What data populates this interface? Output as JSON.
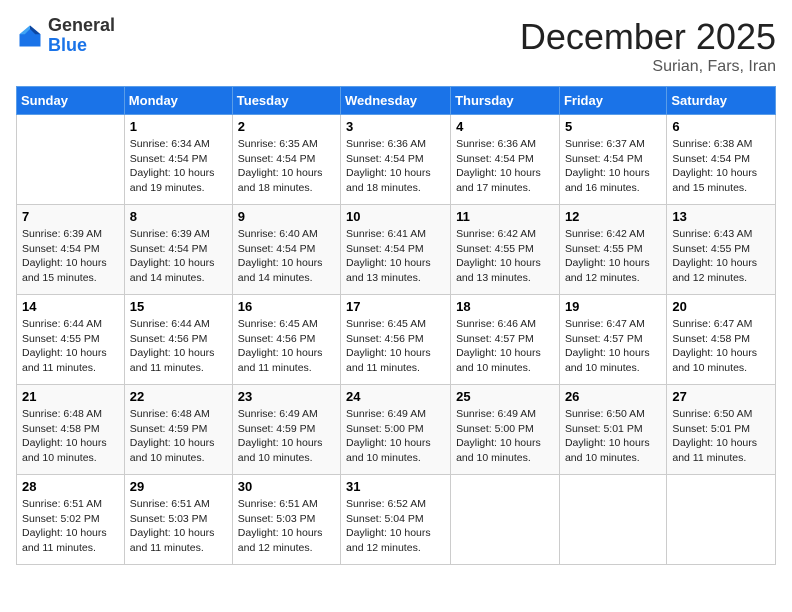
{
  "header": {
    "logo_general": "General",
    "logo_blue": "Blue",
    "title": "December 2025",
    "subtitle": "Surian, Fars, Iran"
  },
  "days_of_week": [
    "Sunday",
    "Monday",
    "Tuesday",
    "Wednesday",
    "Thursday",
    "Friday",
    "Saturday"
  ],
  "weeks": [
    [
      {
        "day": "",
        "info": ""
      },
      {
        "day": "1",
        "info": "Sunrise: 6:34 AM\nSunset: 4:54 PM\nDaylight: 10 hours\nand 19 minutes."
      },
      {
        "day": "2",
        "info": "Sunrise: 6:35 AM\nSunset: 4:54 PM\nDaylight: 10 hours\nand 18 minutes."
      },
      {
        "day": "3",
        "info": "Sunrise: 6:36 AM\nSunset: 4:54 PM\nDaylight: 10 hours\nand 18 minutes."
      },
      {
        "day": "4",
        "info": "Sunrise: 6:36 AM\nSunset: 4:54 PM\nDaylight: 10 hours\nand 17 minutes."
      },
      {
        "day": "5",
        "info": "Sunrise: 6:37 AM\nSunset: 4:54 PM\nDaylight: 10 hours\nand 16 minutes."
      },
      {
        "day": "6",
        "info": "Sunrise: 6:38 AM\nSunset: 4:54 PM\nDaylight: 10 hours\nand 15 minutes."
      }
    ],
    [
      {
        "day": "7",
        "info": "Sunrise: 6:39 AM\nSunset: 4:54 PM\nDaylight: 10 hours\nand 15 minutes."
      },
      {
        "day": "8",
        "info": "Sunrise: 6:39 AM\nSunset: 4:54 PM\nDaylight: 10 hours\nand 14 minutes."
      },
      {
        "day": "9",
        "info": "Sunrise: 6:40 AM\nSunset: 4:54 PM\nDaylight: 10 hours\nand 14 minutes."
      },
      {
        "day": "10",
        "info": "Sunrise: 6:41 AM\nSunset: 4:54 PM\nDaylight: 10 hours\nand 13 minutes."
      },
      {
        "day": "11",
        "info": "Sunrise: 6:42 AM\nSunset: 4:55 PM\nDaylight: 10 hours\nand 13 minutes."
      },
      {
        "day": "12",
        "info": "Sunrise: 6:42 AM\nSunset: 4:55 PM\nDaylight: 10 hours\nand 12 minutes."
      },
      {
        "day": "13",
        "info": "Sunrise: 6:43 AM\nSunset: 4:55 PM\nDaylight: 10 hours\nand 12 minutes."
      }
    ],
    [
      {
        "day": "14",
        "info": "Sunrise: 6:44 AM\nSunset: 4:55 PM\nDaylight: 10 hours\nand 11 minutes."
      },
      {
        "day": "15",
        "info": "Sunrise: 6:44 AM\nSunset: 4:56 PM\nDaylight: 10 hours\nand 11 minutes."
      },
      {
        "day": "16",
        "info": "Sunrise: 6:45 AM\nSunset: 4:56 PM\nDaylight: 10 hours\nand 11 minutes."
      },
      {
        "day": "17",
        "info": "Sunrise: 6:45 AM\nSunset: 4:56 PM\nDaylight: 10 hours\nand 11 minutes."
      },
      {
        "day": "18",
        "info": "Sunrise: 6:46 AM\nSunset: 4:57 PM\nDaylight: 10 hours\nand 10 minutes."
      },
      {
        "day": "19",
        "info": "Sunrise: 6:47 AM\nSunset: 4:57 PM\nDaylight: 10 hours\nand 10 minutes."
      },
      {
        "day": "20",
        "info": "Sunrise: 6:47 AM\nSunset: 4:58 PM\nDaylight: 10 hours\nand 10 minutes."
      }
    ],
    [
      {
        "day": "21",
        "info": "Sunrise: 6:48 AM\nSunset: 4:58 PM\nDaylight: 10 hours\nand 10 minutes."
      },
      {
        "day": "22",
        "info": "Sunrise: 6:48 AM\nSunset: 4:59 PM\nDaylight: 10 hours\nand 10 minutes."
      },
      {
        "day": "23",
        "info": "Sunrise: 6:49 AM\nSunset: 4:59 PM\nDaylight: 10 hours\nand 10 minutes."
      },
      {
        "day": "24",
        "info": "Sunrise: 6:49 AM\nSunset: 5:00 PM\nDaylight: 10 hours\nand 10 minutes."
      },
      {
        "day": "25",
        "info": "Sunrise: 6:49 AM\nSunset: 5:00 PM\nDaylight: 10 hours\nand 10 minutes."
      },
      {
        "day": "26",
        "info": "Sunrise: 6:50 AM\nSunset: 5:01 PM\nDaylight: 10 hours\nand 10 minutes."
      },
      {
        "day": "27",
        "info": "Sunrise: 6:50 AM\nSunset: 5:01 PM\nDaylight: 10 hours\nand 11 minutes."
      }
    ],
    [
      {
        "day": "28",
        "info": "Sunrise: 6:51 AM\nSunset: 5:02 PM\nDaylight: 10 hours\nand 11 minutes."
      },
      {
        "day": "29",
        "info": "Sunrise: 6:51 AM\nSunset: 5:03 PM\nDaylight: 10 hours\nand 11 minutes."
      },
      {
        "day": "30",
        "info": "Sunrise: 6:51 AM\nSunset: 5:03 PM\nDaylight: 10 hours\nand 12 minutes."
      },
      {
        "day": "31",
        "info": "Sunrise: 6:52 AM\nSunset: 5:04 PM\nDaylight: 10 hours\nand 12 minutes."
      },
      {
        "day": "",
        "info": ""
      },
      {
        "day": "",
        "info": ""
      },
      {
        "day": "",
        "info": ""
      }
    ]
  ]
}
